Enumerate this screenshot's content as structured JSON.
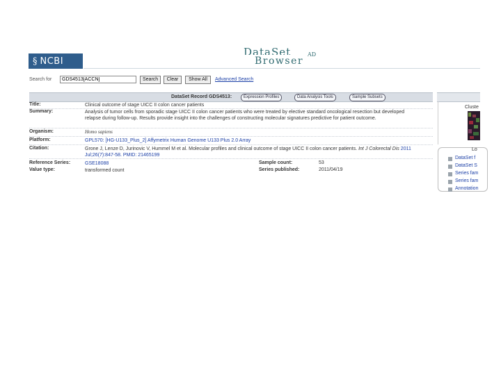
{
  "header": {
    "ncbi_logo": "NCBI",
    "brand_top": "DataSet",
    "brand_bottom": "Browser",
    "brand_sup": "AD"
  },
  "search": {
    "label": "Search for",
    "value": "GDS4513[ACCN]",
    "search_button": "Search",
    "clear_button": "Clear",
    "show_all_button": "Show All",
    "advanced_link": "Advanced Search"
  },
  "record": {
    "title": "DataSet Record GDS4513:",
    "tabs": [
      "Expression Profiles",
      "Data Analysis Tools",
      "Sample Subsets"
    ],
    "fields": {
      "title_label": "Title:",
      "title_value": "Clinical outcome of stage UICC II colon cancer patients",
      "summary_label": "Summary:",
      "summary_value": "Analysis of tumor cells from sporadic stage UICC II colon cancer patients who were treated by elective standard oncological resection but developed relapse during follow-up. Results provide insight into the challenges of constructing molecular signatures predictive for patient outcome.",
      "organism_label": "Organism:",
      "organism_value": "Homo sapiens",
      "platform_label": "Platform:",
      "platform_value": "GPL570: [HG-U133_Plus_2] Affymetrix Human Genome U133 Plus 2.0 Array",
      "citation_label": "Citation:",
      "citation_value_1": "Grone J, Lenze D, Jurinovic V, Hummel M et al. Molecular profiles and clinical outcome of stage UICC II colon cancer patients. ",
      "citation_journal": "Int J Colorectal Dis",
      "citation_value_2": "2011 Jul;26(7):847-58. PMID: 21465199",
      "ref_series_label": "Reference Series:",
      "ref_series_value": "GSE18088",
      "value_type_label": "Value type:",
      "value_type_value": "transformed count",
      "sample_count_label": "Sample count:",
      "sample_count_value": "53",
      "series_published_label": "Series published:",
      "series_published_value": "2011/04/19"
    }
  },
  "side": {
    "cluster_label": "Cluste",
    "box_title": "Lo",
    "items": [
      "DataSet f",
      "DataSet S",
      "Series fam",
      "Series fam",
      "Annotation"
    ]
  },
  "colors": {
    "ncbi_blue": "#2f5d8c",
    "link_blue": "#1a3ea6",
    "bar_gray": "#d8dde4"
  }
}
